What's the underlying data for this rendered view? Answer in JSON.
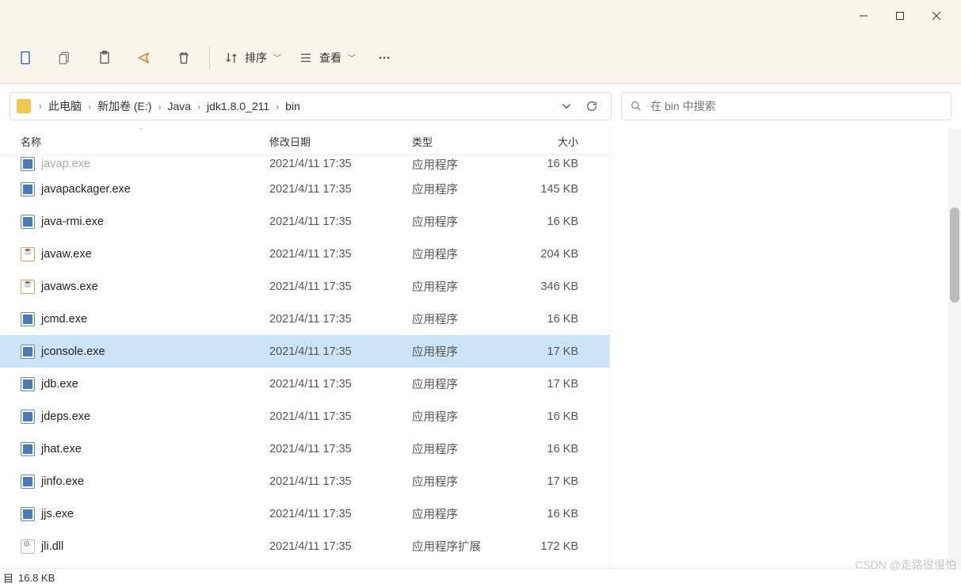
{
  "window": {
    "minimize": "—",
    "maximize": "☐",
    "close": "✕"
  },
  "toolbar": {
    "sort_label": "排序",
    "view_label": "查看"
  },
  "breadcrumbs": [
    "此电脑",
    "新加卷 (E:)",
    "Java",
    "jdk1.8.0_211",
    "bin"
  ],
  "search": {
    "placeholder": "在 bin 中搜索"
  },
  "columns": {
    "name": "名称",
    "date": "修改日期",
    "type": "类型",
    "size": "大小"
  },
  "files": [
    {
      "name": "javap.exe",
      "date": "2021/4/11 17:35",
      "type": "应用程序",
      "size": "16 KB",
      "icon": "exe",
      "cut": true
    },
    {
      "name": "javapackager.exe",
      "date": "2021/4/11 17:35",
      "type": "应用程序",
      "size": "145 KB",
      "icon": "exe"
    },
    {
      "name": "java-rmi.exe",
      "date": "2021/4/11 17:35",
      "type": "应用程序",
      "size": "16 KB",
      "icon": "exe"
    },
    {
      "name": "javaw.exe",
      "date": "2021/4/11 17:35",
      "type": "应用程序",
      "size": "204 KB",
      "icon": "java"
    },
    {
      "name": "javaws.exe",
      "date": "2021/4/11 17:35",
      "type": "应用程序",
      "size": "346 KB",
      "icon": "java"
    },
    {
      "name": "jcmd.exe",
      "date": "2021/4/11 17:35",
      "type": "应用程序",
      "size": "16 KB",
      "icon": "exe"
    },
    {
      "name": "jconsole.exe",
      "date": "2021/4/11 17:35",
      "type": "应用程序",
      "size": "17 KB",
      "icon": "exe",
      "selected": true
    },
    {
      "name": "jdb.exe",
      "date": "2021/4/11 17:35",
      "type": "应用程序",
      "size": "17 KB",
      "icon": "exe"
    },
    {
      "name": "jdeps.exe",
      "date": "2021/4/11 17:35",
      "type": "应用程序",
      "size": "16 KB",
      "icon": "exe"
    },
    {
      "name": "jhat.exe",
      "date": "2021/4/11 17:35",
      "type": "应用程序",
      "size": "16 KB",
      "icon": "exe"
    },
    {
      "name": "jinfo.exe",
      "date": "2021/4/11 17:35",
      "type": "应用程序",
      "size": "17 KB",
      "icon": "exe"
    },
    {
      "name": "jjs.exe",
      "date": "2021/4/11 17:35",
      "type": "应用程序",
      "size": "16 KB",
      "icon": "exe"
    },
    {
      "name": "jli.dll",
      "date": "2021/4/11 17:35",
      "type": "应用程序扩展",
      "size": "172 KB",
      "icon": "dll"
    }
  ],
  "status": {
    "count_label": "目",
    "size": "16.8 KB"
  },
  "watermark": "CSDN @走路很慢怕"
}
